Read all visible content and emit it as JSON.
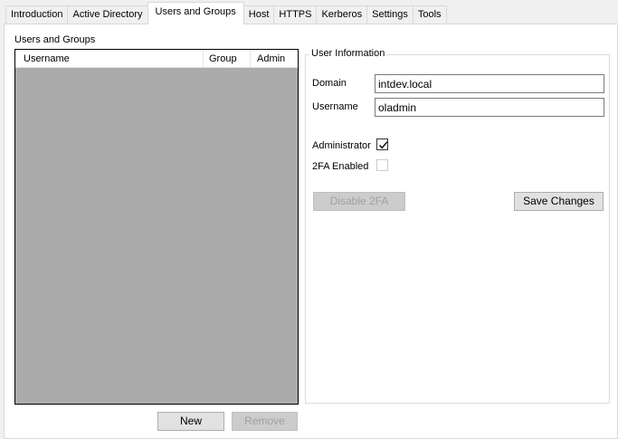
{
  "tabs": [
    {
      "label": "Introduction"
    },
    {
      "label": "Active Directory"
    },
    {
      "label": "Users and Groups",
      "active": true
    },
    {
      "label": "Host"
    },
    {
      "label": "HTTPS"
    },
    {
      "label": "Kerberos"
    },
    {
      "label": "Settings"
    },
    {
      "label": "Tools"
    }
  ],
  "users_groups": {
    "title": "Users and Groups",
    "columns": [
      "Username",
      "Group",
      "Admin"
    ],
    "rows": [],
    "new_label": "New",
    "remove_label": "Remove"
  },
  "user_info": {
    "title": "User Information",
    "domain_label": "Domain",
    "domain_value": "intdev.local",
    "username_label": "Username",
    "username_value": "oladmin",
    "administrator_label": "Administrator",
    "administrator_checked": true,
    "twofa_label": "2FA Enabled",
    "twofa_checked": false,
    "disable_2fa_label": "Disable 2FA",
    "save_label": "Save Changes"
  },
  "colors": {
    "list_background": "#ababab",
    "window_background": "#f0f0f0"
  }
}
